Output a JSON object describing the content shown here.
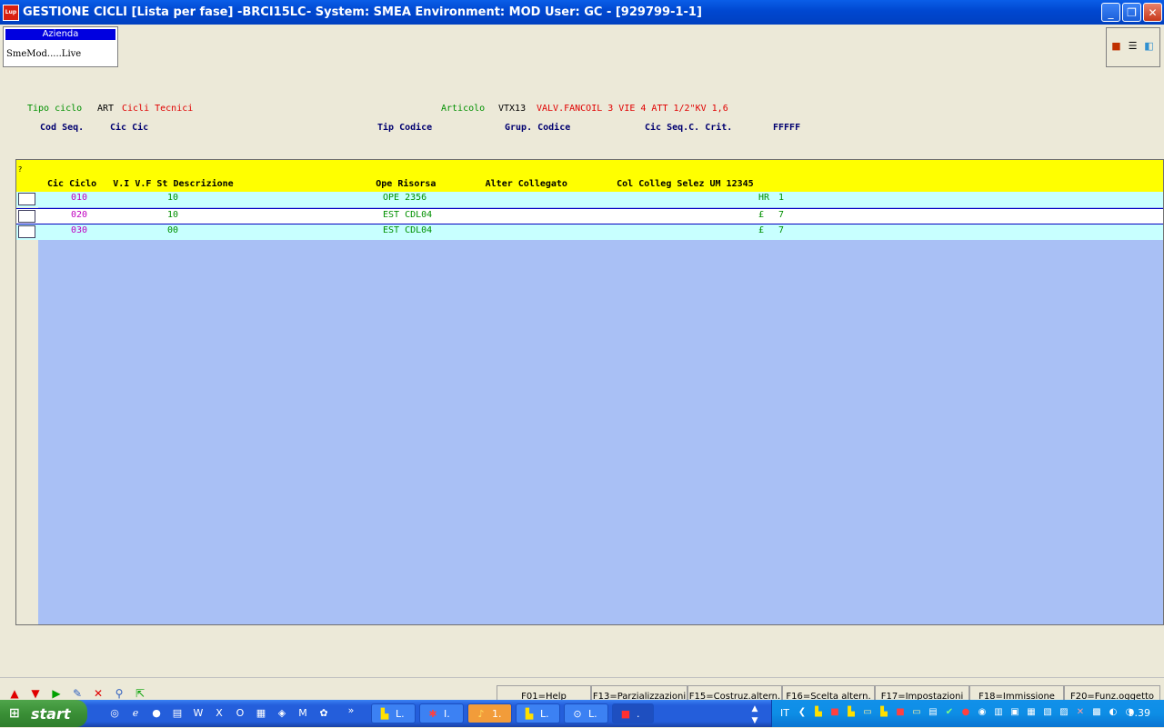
{
  "window": {
    "title": "GESTIONE CICLI [Lista per fase] -BRCI15LC- System: SMEA Environment: MOD User: GC - [929799-1-1]",
    "app_icon": "Lup",
    "buttons": {
      "minimize": "_",
      "restore": "❐",
      "close": "✕"
    }
  },
  "azienda": {
    "header": "Azienda",
    "value": "SmeMod.....Live"
  },
  "toolbar_icons": [
    "monitor-icon",
    "list-icon",
    "book-icon"
  ],
  "header": {
    "tipo_ciclo_label": "Tipo ciclo",
    "tipo_ciclo_code": "ART",
    "tipo_ciclo_desc": "Cicli Tecnici",
    "articolo_label": "Articolo",
    "articolo_code": "VTX13",
    "articolo_desc": "VALV.FANCOIL 3 VIE 4 ATT 1/2\"KV 1,6",
    "subheader": {
      "cod_seq": "Cod Seq.",
      "cic_cic": "Cic Cic",
      "tip_codice": "Tip Codice",
      "grup_codice": "Grup. Codice",
      "cic_seq_crit": "Cic Seq.C. Crit.",
      "fffff": "FFFFF"
    }
  },
  "grid": {
    "corner": "?",
    "columns": "Cic Ciclo   V.I V.F St Descrizione                          Ope Risorsa         Alter Collegato         Col Colleg Selez UM 12345",
    "rows": [
      {
        "ciclo": "010",
        "vf": "10",
        "ope_risorsa": "OPE 2356",
        "um": "HR",
        "val": "1"
      },
      {
        "ciclo": "020",
        "vf": "10",
        "ope_risorsa": "EST CDL04",
        "um": "£",
        "val": "7"
      },
      {
        "ciclo": "030",
        "vf": "00",
        "ope_risorsa": "EST CDL04",
        "um": "£",
        "val": "7"
      }
    ]
  },
  "function_keys": [
    "F01=Help",
    "F13=Parzializzazioni",
    "F15=Costruz.altern.",
    "F16=Scelta altern.",
    "F17=Impostazioni",
    "F18=Immissione",
    "F20=Funz.oggetto"
  ],
  "taskbar": {
    "start": "start",
    "overflow": "»",
    "tasks": [
      {
        "label": "L.",
        "icon": "loox-icon"
      },
      {
        "label": "I.",
        "icon": "network-icon"
      },
      {
        "label": "1.",
        "icon": "bell-icon"
      },
      {
        "label": "L.",
        "icon": "loox-icon"
      },
      {
        "label": "L.",
        "icon": "toggle-icon"
      },
      {
        "label": ".",
        "icon": "lup-icon"
      }
    ],
    "language": "IT",
    "clock": "9.39"
  }
}
